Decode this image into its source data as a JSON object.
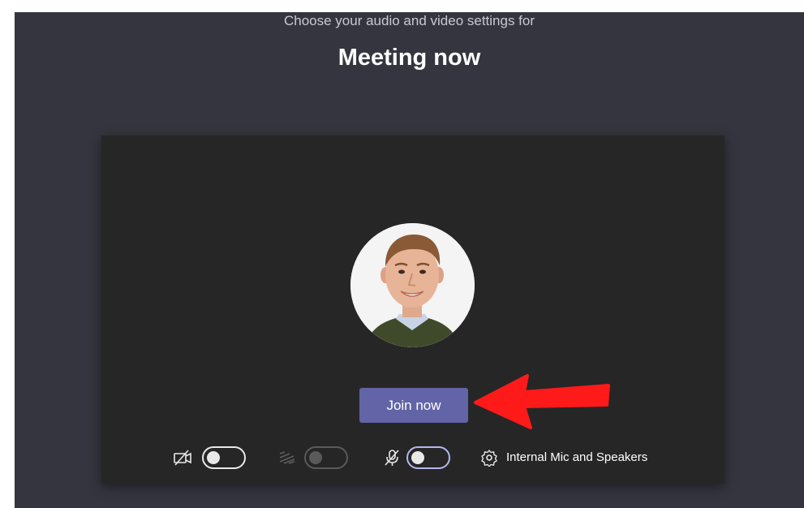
{
  "header": {
    "subtitle": "Choose your audio and video settings for",
    "title": "Meeting now"
  },
  "preview": {
    "avatar": "user-avatar-photo",
    "join_label": "Join now"
  },
  "controls": {
    "camera": {
      "icon": "camera-off-icon",
      "on": false
    },
    "background": {
      "icon": "background-blur-icon",
      "enabled": false
    },
    "microphone": {
      "icon": "mic-off-icon",
      "on": false
    },
    "device": {
      "icon": "gear-icon",
      "label": "Internal Mic and Speakers"
    }
  },
  "annotation": {
    "icon": "red-arrow-pointer",
    "color": "#ff1a1a"
  },
  "colors": {
    "stage_bg": "#35353f",
    "preview_bg": "#262626",
    "accent": "#6264a7"
  }
}
